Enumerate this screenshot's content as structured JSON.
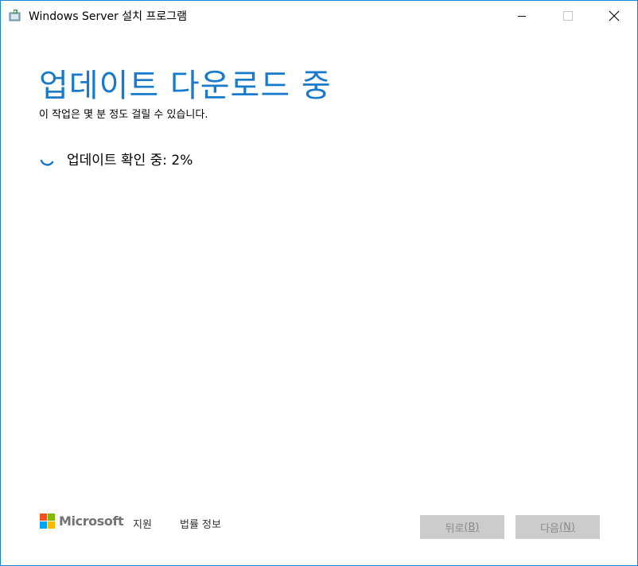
{
  "window": {
    "title": "Windows Server 설치 프로그램",
    "accent_color": "#1979ca",
    "border_color": "#1883d7"
  },
  "titlebar": {
    "app_icon": "setup-app-icon",
    "minimize_icon": "minimize-icon",
    "maximize_icon": "maximize-icon",
    "close_icon": "close-icon"
  },
  "main": {
    "heading": "업데이트 다운로드 중",
    "subtitle": "이 작업은 몇 분 정도 걸릴 수 있습니다.",
    "status_text": "업데이트 확인 중: 2%",
    "progress_percent": 2,
    "spinner_icon": "loading-spinner-icon"
  },
  "footer": {
    "brand": "Microsoft",
    "logo_colors": [
      "#f25022",
      "#7fba00",
      "#00a4ef",
      "#ffb900"
    ],
    "links": [
      "지원",
      "법률 정보"
    ],
    "back_button": {
      "label": "뒤로",
      "accesskey": "(B)"
    },
    "next_button": {
      "label": "다음",
      "accesskey": "(N)"
    }
  }
}
